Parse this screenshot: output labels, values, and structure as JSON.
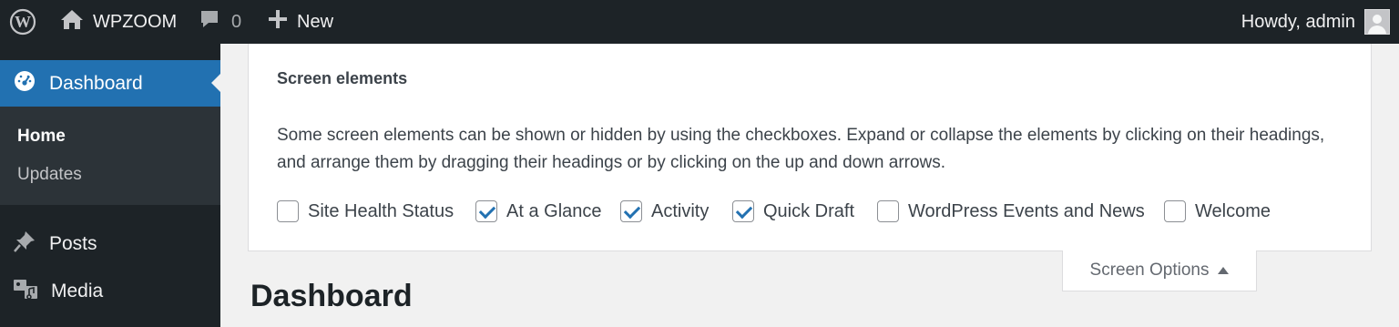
{
  "adminbar": {
    "site_name": "WPZOOM",
    "comments_count": "0",
    "new_label": "New",
    "howdy": "Howdy, admin"
  },
  "sidebar": {
    "dashboard_label": "Dashboard",
    "submenu": [
      {
        "label": "Home"
      },
      {
        "label": "Updates"
      }
    ],
    "items": [
      {
        "label": "Posts",
        "icon": "pin-icon"
      },
      {
        "label": "Media",
        "icon": "media-icon"
      }
    ]
  },
  "screen_options": {
    "title": "Screen elements",
    "description": "Some screen elements can be shown or hidden by using the checkboxes. Expand or collapse the elements by clicking on their headings, and arrange them by dragging their headings or by clicking on the up and down arrows.",
    "options": [
      {
        "label": "Site Health Status",
        "checked": false
      },
      {
        "label": "At a Glance",
        "checked": true
      },
      {
        "label": "Activity",
        "checked": true
      },
      {
        "label": "Quick Draft",
        "checked": true
      },
      {
        "label": "WordPress Events and News",
        "checked": false
      },
      {
        "label": "Welcome",
        "checked": false
      }
    ],
    "tab_label": "Screen Options"
  },
  "page": {
    "title": "Dashboard"
  },
  "colors": {
    "admin_bar": "#1d2327",
    "accent": "#2271b1",
    "background": "#f1f1f1"
  }
}
